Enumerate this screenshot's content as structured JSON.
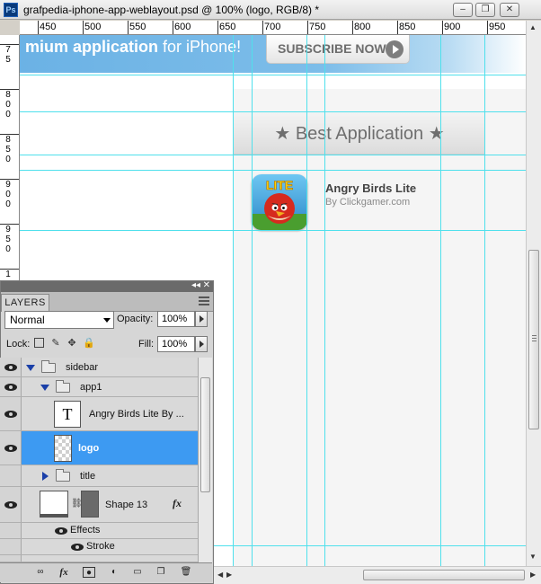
{
  "window": {
    "title": "grafpedia-iphone-app-weblayout.psd @ 100% (logo, RGB/8) *",
    "app_icon": "Ps",
    "buttons": [
      {
        "name": "minimize-icon",
        "glyph": "–"
      },
      {
        "name": "restore-icon",
        "glyph": "❐"
      },
      {
        "name": "close-icon",
        "glyph": "✕"
      }
    ]
  },
  "ruler": {
    "top_labels": [
      "450",
      "500",
      "550",
      "600",
      "650",
      "700",
      "750",
      "800",
      "850",
      "900",
      "950"
    ],
    "left_labels": [
      {
        "digits": [
          "7",
          "5"
        ]
      },
      {
        "digits": [
          "8",
          "0",
          "0"
        ]
      },
      {
        "digits": [
          "8",
          "5",
          "0"
        ]
      },
      {
        "digits": [
          "9",
          "0",
          "0"
        ]
      },
      {
        "digits": [
          "9",
          "5",
          "0"
        ]
      },
      {
        "digits": [
          "1"
        ]
      }
    ]
  },
  "canvas": {
    "banner_bold": "mium application",
    "banner_light": " for iPhone!",
    "subscribe_label": "SUBSCRIBE NOW",
    "section_title": "★ Best Application ★",
    "app": {
      "name": "Angry Birds Lite",
      "by": "By Clickgamer.com",
      "logo_badge": "LITE"
    }
  },
  "layers_panel": {
    "tab": "LAYERS",
    "blend_mode": "Normal",
    "opacity_label": "Opacity:",
    "opacity_value": "100%",
    "lock_label": "Lock:",
    "fill_label": "Fill:",
    "fill_value": "100%",
    "layers": [
      {
        "name": "sidebar",
        "type": "group",
        "expanded": true,
        "selected": false
      },
      {
        "name": "app1",
        "type": "group",
        "expanded": true,
        "selected": false
      },
      {
        "name": "Angry Birds Lite By ...",
        "type": "text",
        "selected": false
      },
      {
        "name": "logo",
        "type": "image",
        "selected": true
      },
      {
        "name": "title",
        "type": "group",
        "expanded": false,
        "selected": false
      },
      {
        "name": "Shape 13",
        "type": "shape",
        "selected": false
      },
      {
        "name": "Effects",
        "type": "effects",
        "selected": false
      },
      {
        "name": "Stroke",
        "type": "effect",
        "selected": false
      }
    ],
    "footer_icons": [
      "link-layers-icon",
      "fx-icon",
      "mask-icon",
      "adjustment-icon",
      "new-group-icon",
      "new-layer-icon",
      "delete-icon"
    ]
  },
  "colors": {
    "guide": "#4fe0ec",
    "selection": "#3d9af2",
    "banner": "#6bb2e5"
  }
}
